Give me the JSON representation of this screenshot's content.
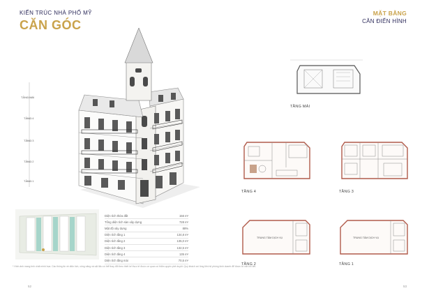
{
  "header": {
    "kicker": "KIẾN TRÚC NHÀ PHỐ MỸ",
    "title": "CĂN GÓC",
    "right_title": "MẶT BẰNG",
    "right_subtitle": "CĂN ĐIỂN HÌNH"
  },
  "elevation_labels": [
    "TẦNG MÁI",
    "TẦNG 4",
    "TẦNG 3",
    "TẦNG 2",
    "TẦNG 1"
  ],
  "plans": {
    "roof": "TẦNG MÁI",
    "f4": "TẦNG 4",
    "f3": "TẦNG 3",
    "f2": "TẦNG 2",
    "f1": "TẦNG 1",
    "f2_room": "TRUNG TÂM DỊCH VỤ",
    "f1_room": "TRUNG TÂM DỊCH VỤ"
  },
  "specs": [
    {
      "label": "Diện tích thửa đất",
      "value": "156 m²"
    },
    {
      "label": "Tổng diện tích sàn xây dựng",
      "value": "728 m²"
    },
    {
      "label": "Mật độ xây dựng",
      "value": "88%"
    },
    {
      "label": "Diện tích tầng 1",
      "value": "134,8 m²"
    },
    {
      "label": "Diện tích tầng 2",
      "value": "135,0 m²"
    },
    {
      "label": "Diện tích tầng 3",
      "value": "132,5 m²"
    },
    {
      "label": "Diện tích tầng 4",
      "value": "135 m²"
    },
    {
      "label": "Diện tích tầng mái",
      "value": "70,5 m²"
    }
  ],
  "footnote": "* Hình ảnh mang tính chất minh họa. Các thông tin về diện tích, công năng và vật liệu có thể thay đổi theo thiết kế thực tế được cơ quan có thẩm quyền phê duyệt. Quý khách vui lòng liên hệ phòng kinh doanh để được tư vấn chi tiết.",
  "page_left": "52",
  "page_right": "53",
  "colors": {
    "gold": "#c9a24a",
    "navy": "#2c2a5a",
    "wall": "#b05a4a"
  }
}
